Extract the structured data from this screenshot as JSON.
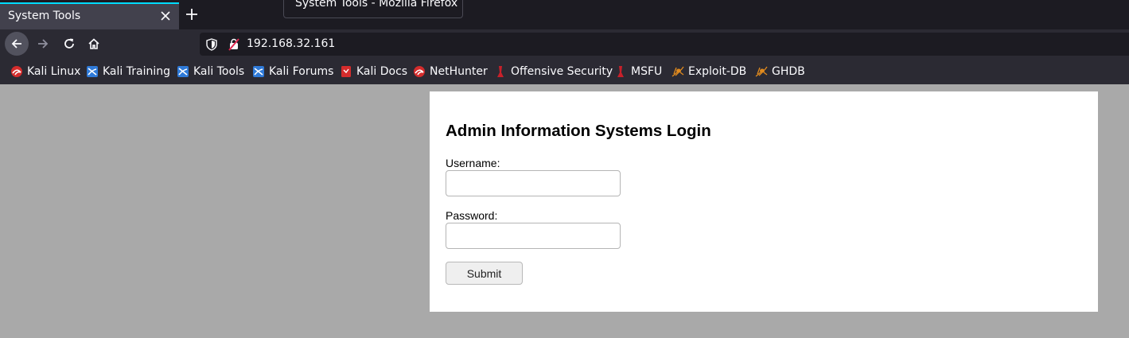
{
  "browser": {
    "tab_title": "System Tools",
    "window_tooltip": "System Tools - Mozilla Firefox",
    "url": "192.168.32.161"
  },
  "bookmarks": [
    {
      "label": "Kali Linux",
      "icon": "kali-dragon-icon"
    },
    {
      "label": "Kali Training",
      "icon": "kali-training-icon"
    },
    {
      "label": "Kali Tools",
      "icon": "kali-tools-icon"
    },
    {
      "label": "Kali Forums",
      "icon": "kali-forums-icon"
    },
    {
      "label": "Kali Docs",
      "icon": "kali-docs-icon"
    },
    {
      "label": "NetHunter",
      "icon": "nethunter-icon"
    },
    {
      "label": "Offensive Security",
      "icon": "offsec-icon"
    },
    {
      "label": "MSFU",
      "icon": "msfu-icon"
    },
    {
      "label": "Exploit-DB",
      "icon": "exploitdb-spider-icon"
    },
    {
      "label": "GHDB",
      "icon": "ghdb-spider-icon"
    }
  ],
  "page": {
    "heading": "Admin Information Systems Login",
    "username_label": "Username:",
    "username_value": "",
    "password_label": "Password:",
    "password_value": "",
    "submit_label": "Submit"
  },
  "colors": {
    "tab_accent": "#00ddff",
    "page_background": "#a9a9a9",
    "card_background": "#ffffff",
    "chrome_background": "#2b2a33"
  }
}
